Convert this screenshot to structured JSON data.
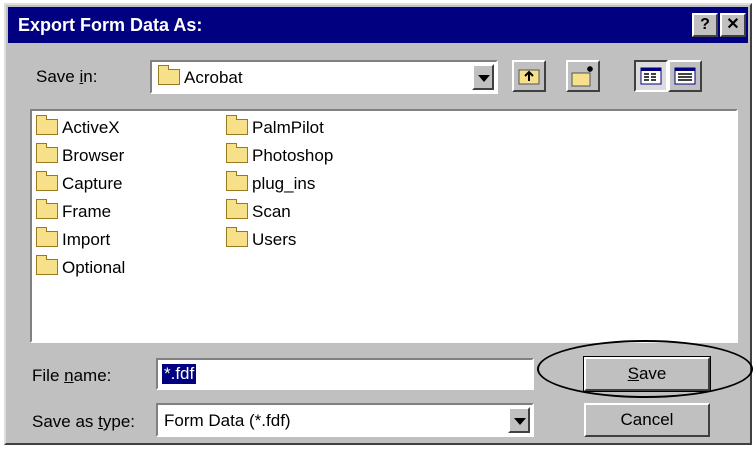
{
  "title": "Export Form Data As:",
  "titlebar_buttons": {
    "help": "?",
    "close": "✕"
  },
  "save_in": {
    "label_pre": "Save ",
    "label_key": "i",
    "label_post": "n:",
    "value": "Acrobat"
  },
  "toolbar": {
    "icons": [
      "up-one-level-icon",
      "create-new-folder-icon",
      "list-view-icon",
      "details-view-icon"
    ]
  },
  "files": {
    "col1": [
      "ActiveX",
      "Browser",
      "Capture",
      "Frame",
      "Import",
      "Optional"
    ],
    "col2": [
      "PalmPilot",
      "Photoshop",
      "plug_ins",
      "Scan",
      "Users"
    ]
  },
  "file_name": {
    "label_pre": "File ",
    "label_key": "n",
    "label_post": "ame:",
    "value": "*.fdf"
  },
  "save_as_type": {
    "label_pre": "Save as ",
    "label_key": "t",
    "label_post": "ype:",
    "value": "Form Data (*.fdf)"
  },
  "buttons": {
    "save_key": "S",
    "save_rest": "ave",
    "cancel": "Cancel"
  },
  "colors": {
    "titlebar": "#000080",
    "face": "#c0c0c0",
    "selection": "#000080"
  }
}
